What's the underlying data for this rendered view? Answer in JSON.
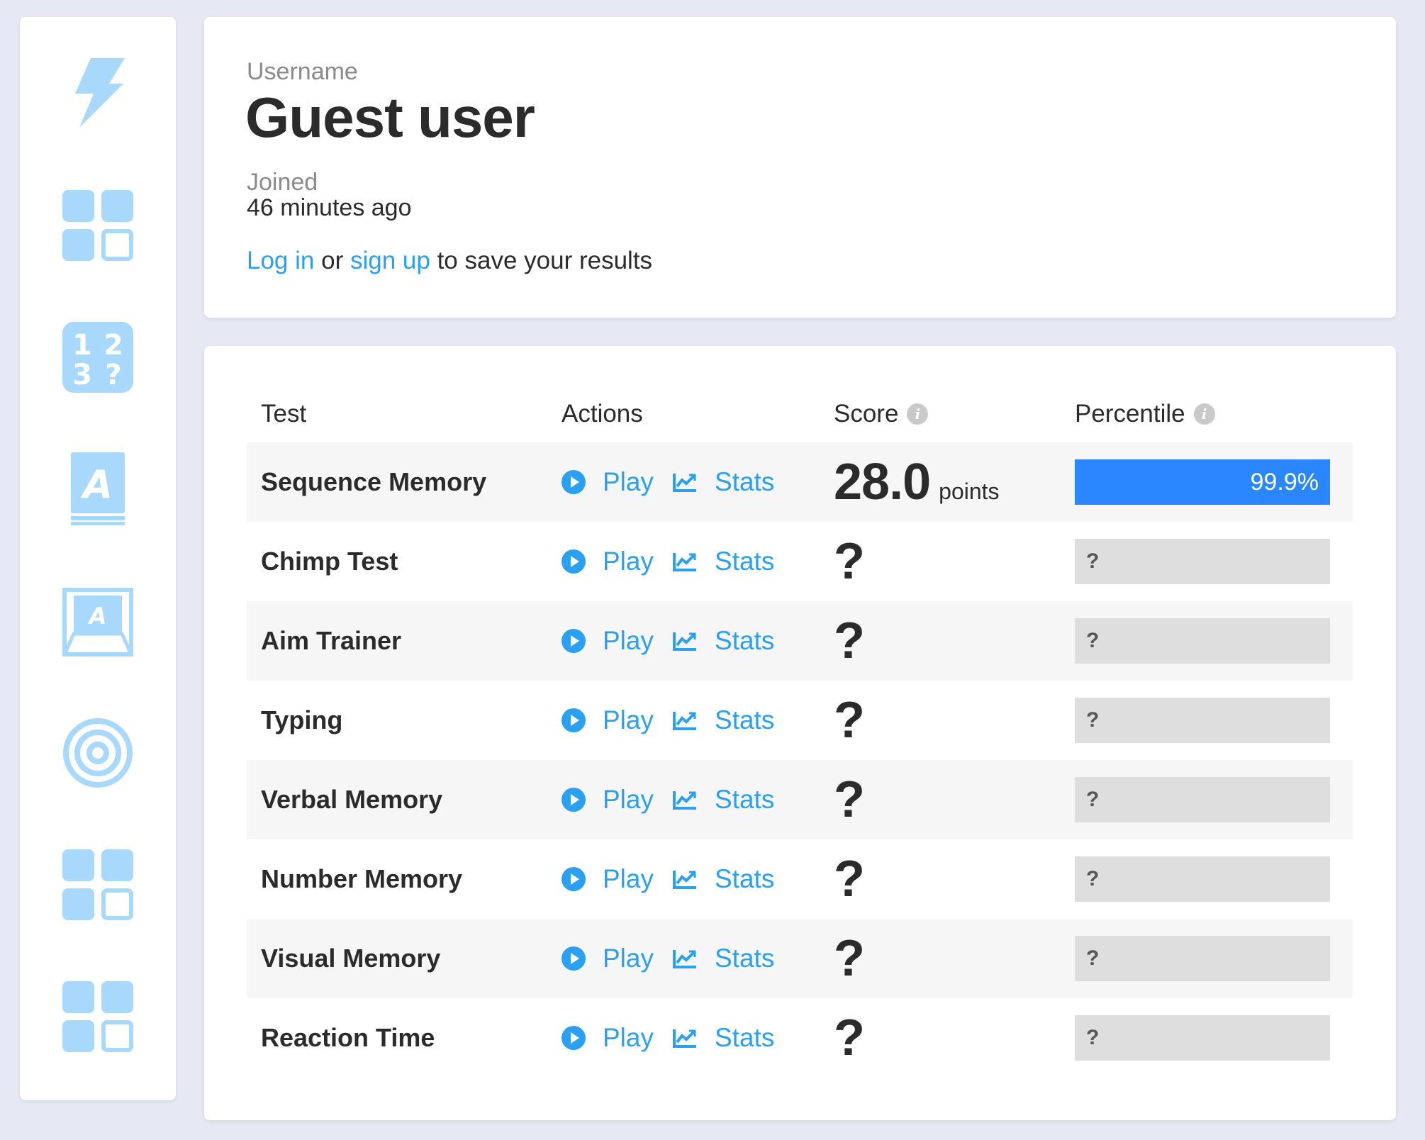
{
  "profile": {
    "username_label": "Username",
    "username": "Guest user",
    "joined_label": "Joined",
    "joined": "46 minutes ago",
    "login_link": "Log in",
    "or_text": "or",
    "signup_link": "sign up",
    "save_text": "to save your results"
  },
  "sidebar": {
    "icons": [
      "lightning-icon",
      "grid-icon",
      "number-memory-icon",
      "verbal-book-icon",
      "keyboard-key-icon",
      "target-icon",
      "grid-icon",
      "grid-icon"
    ]
  },
  "table": {
    "headers": {
      "test": "Test",
      "actions": "Actions",
      "score": "Score",
      "percentile": "Percentile"
    },
    "info_glyph": "i",
    "play_label": "Play",
    "stats_label": "Stats",
    "rows": [
      {
        "name": "Sequence Memory",
        "score": "28.0",
        "unit": "points",
        "percentile": "99.9%",
        "percentile_fraction": 1.0
      },
      {
        "name": "Chimp Test",
        "score": "?",
        "percentile": "?"
      },
      {
        "name": "Aim Trainer",
        "score": "?",
        "percentile": "?"
      },
      {
        "name": "Typing",
        "score": "?",
        "percentile": "?"
      },
      {
        "name": "Verbal Memory",
        "score": "?",
        "percentile": "?"
      },
      {
        "name": "Number Memory",
        "score": "?",
        "percentile": "?"
      },
      {
        "name": "Visual Memory",
        "score": "?",
        "percentile": "?"
      },
      {
        "name": "Reaction Time",
        "score": "?",
        "percentile": "?"
      }
    ]
  },
  "colors": {
    "accent": "#2b9ff0",
    "bar": "#2b87ff",
    "icon": "#a8d8fc",
    "background": "#e6e8f4"
  }
}
